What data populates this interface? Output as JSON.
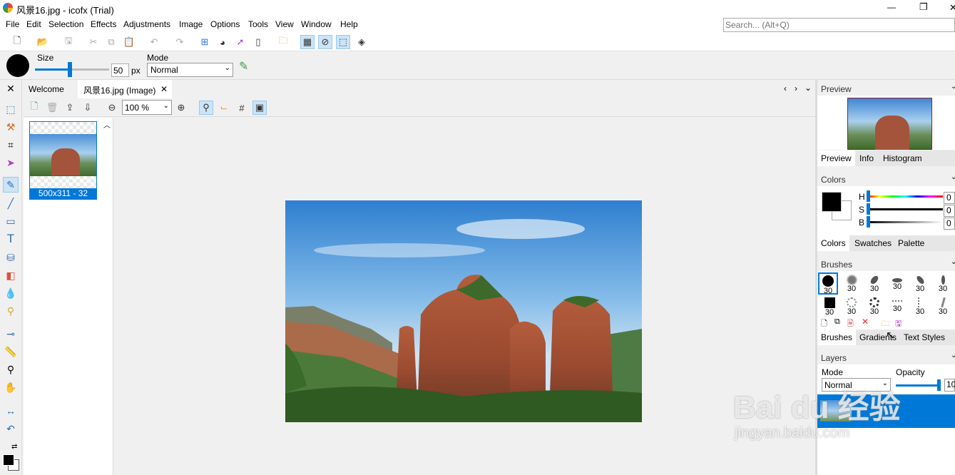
{
  "window": {
    "title": "风景16.jpg - icofx (Trial)",
    "controls": {
      "minimize": "—",
      "maximize": "❐",
      "close": "✕"
    }
  },
  "menu": [
    "File",
    "Edit",
    "Selection",
    "Effects",
    "Adjustments",
    "Image",
    "Options",
    "Tools",
    "View",
    "Window",
    "Help"
  ],
  "search": {
    "placeholder": "Search... (Alt+Q)"
  },
  "options": {
    "size_label": "Size",
    "size_value": "50",
    "size_unit": "px",
    "mode_label": "Mode",
    "mode_value": "Normal",
    "size_slider_level": 0.47
  },
  "tabs": {
    "welcome": "Welcome",
    "document": "风景16.jpg (Image)",
    "close": "✕"
  },
  "zoom": {
    "value": "100 %"
  },
  "frame": {
    "label": "500x311 - 32"
  },
  "right": {
    "preview_title": "Preview",
    "preview_tabs": [
      "Preview",
      "Info",
      "Histogram"
    ],
    "colors_title": "Colors",
    "hsb": [
      {
        "label": "H",
        "value": "0"
      },
      {
        "label": "S",
        "value": "0"
      },
      {
        "label": "B",
        "value": "0"
      }
    ],
    "colors_tabs": [
      "Colors",
      "Swatches",
      "Palette"
    ],
    "brushes_title": "Brushes",
    "brush_sizes": [
      "30",
      "30",
      "30",
      "30",
      "30",
      "30"
    ],
    "brush_sizes_row2": [
      "30",
      "30",
      "30",
      "30",
      "30",
      "30"
    ],
    "brushes_tabs": [
      "Brushes",
      "Gradients",
      "Text Styles"
    ],
    "layers_title": "Layers",
    "layers_mode_label": "Mode",
    "layers_opacity_label": "Opacity",
    "layers_mode_value": "Normal",
    "layers_opacity_value": "10"
  },
  "watermark": {
    "brand": "Bai du 经验",
    "url": "jingyan.baidu.com"
  },
  "colors": {
    "accent": "#0078d7",
    "selection": "#cce4f7",
    "frame_label_bg": "#0078d7"
  }
}
